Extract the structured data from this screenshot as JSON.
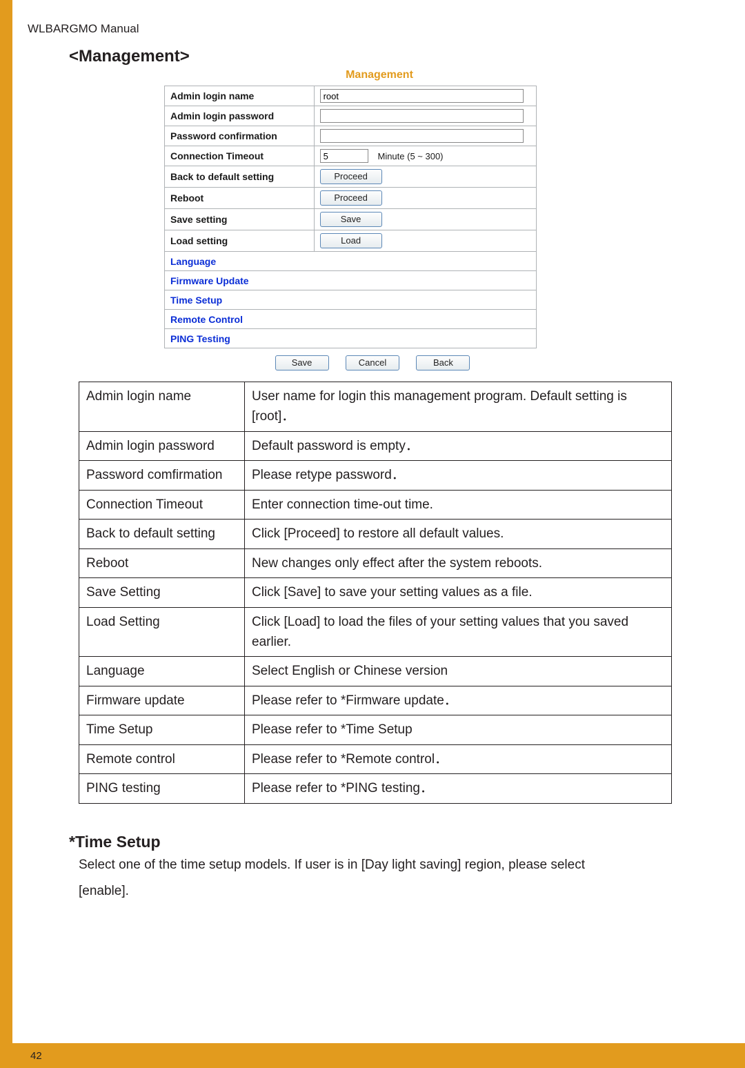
{
  "header": {
    "title": "WLBARGMO Manual"
  },
  "section": {
    "heading": "<Management>",
    "panel_title": "Management"
  },
  "config": {
    "rows": {
      "admin_login_name": {
        "label": "Admin login name",
        "value": "root"
      },
      "admin_login_password": {
        "label": "Admin login password",
        "value": ""
      },
      "password_confirmation": {
        "label": "Password confirmation",
        "value": ""
      },
      "connection_timeout": {
        "label": "Connection Timeout",
        "value": "5",
        "unit": "Minute (5 ~ 300)"
      },
      "back_to_default": {
        "label": "Back to default setting",
        "button": "Proceed"
      },
      "reboot": {
        "label": "Reboot",
        "button": "Proceed"
      },
      "save_setting": {
        "label": "Save setting",
        "button": "Save"
      },
      "load_setting": {
        "label": "Load setting",
        "button": "Load"
      }
    },
    "links": [
      "Language",
      "Firmware Update",
      "Time Setup",
      "Remote Control",
      "PING Testing"
    ],
    "bottom_buttons": {
      "save": "Save",
      "cancel": "Cancel",
      "back": "Back"
    }
  },
  "desc": [
    {
      "k": "Admin login name",
      "v": "User name for login this management program. Default setting is [root]．"
    },
    {
      "k": "Admin login password",
      "v": "Default password is empty．"
    },
    {
      "k": "Password comfirmation",
      "v": "Please retype password．"
    },
    {
      "k": "Connection Timeout",
      "v": "Enter connection time-out time."
    },
    {
      "k": "Back to default setting",
      "v": "Click [Proceed] to restore all default values."
    },
    {
      "k": "Reboot",
      "v": "New changes only effect after the system reboots."
    },
    {
      "k": "Save Setting",
      "v": "Click [Save] to save your setting values as a file."
    },
    {
      "k": "Load Setting",
      "v": "Click [Load] to load the files of your setting values that you saved earlier."
    },
    {
      "k": "Language",
      "v": "Select English or Chinese version"
    },
    {
      "k": "Firmware update",
      "v": "Please refer to *Firmware update．"
    },
    {
      "k": "Time Setup",
      "v": "Please refer to *Time Setup"
    },
    {
      "k": "Remote control",
      "v": "Please refer to *Remote control．"
    },
    {
      "k": "PING testing",
      "v": "Please refer to *PING testing．"
    }
  ],
  "time_setup": {
    "heading": "*Time Setup",
    "text1": "Select one of the time setup models. If user is in [Day light saving] region, please select",
    "text2": "[enable]."
  },
  "footer": {
    "page_number": "42"
  }
}
